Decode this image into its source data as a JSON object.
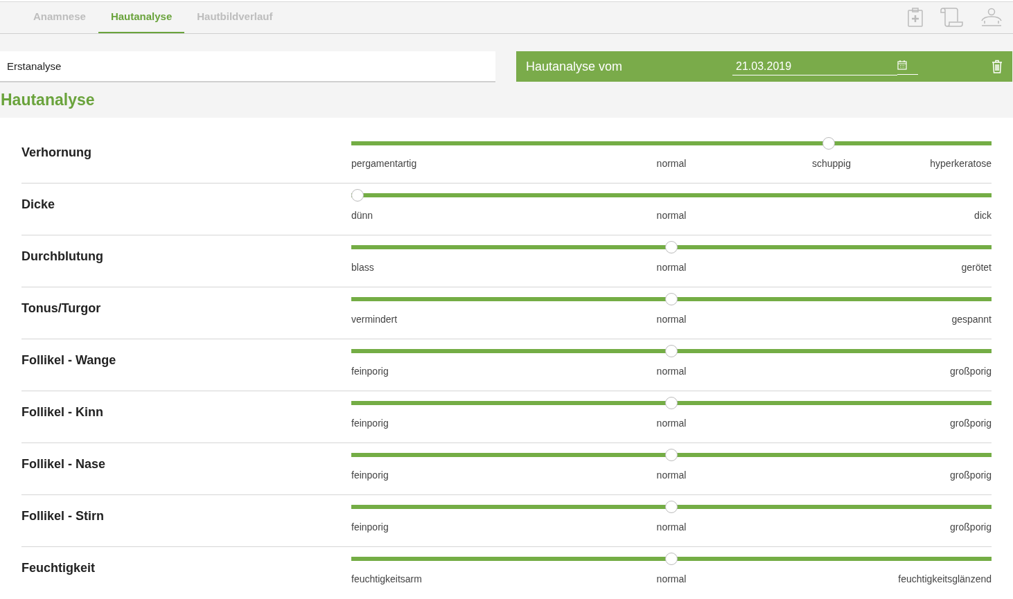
{
  "tabs": [
    {
      "label": "Anamnese",
      "selected": false
    },
    {
      "label": "Hautanalyse",
      "selected": true
    },
    {
      "label": "Hautbildverlauf",
      "selected": false
    }
  ],
  "analysis_name": {
    "value": "Erstanalyse"
  },
  "date_bar": {
    "label": "Hautanalyse vom",
    "date": "21.03.2019"
  },
  "section_title": "Hautanalyse",
  "rows": [
    {
      "name": "Verhornung",
      "level": 0.75,
      "scale": [
        "pergamentartig",
        "normal",
        "schuppig",
        "hyperkeratose"
      ]
    },
    {
      "name": "Dicke",
      "level": 0,
      "scale": [
        "dünn",
        "normal",
        "dick"
      ]
    },
    {
      "name": "Durchblutung",
      "level": 0.5,
      "scale": [
        "blass",
        "normal",
        "gerötet"
      ]
    },
    {
      "name": "Tonus/Turgor",
      "level": 0.5,
      "scale": [
        "vermindert",
        "normal",
        "gespannt"
      ]
    },
    {
      "name": "Follikel - Wange",
      "level": 0.5,
      "scale": [
        "feinporig",
        "normal",
        "großporig"
      ]
    },
    {
      "name": "Follikel - Kinn",
      "level": 0.5,
      "scale": [
        "feinporig",
        "normal",
        "großporig"
      ]
    },
    {
      "name": "Follikel - Nase",
      "level": 0.5,
      "scale": [
        "feinporig",
        "normal",
        "großporig"
      ]
    },
    {
      "name": "Follikel - Stirn",
      "level": 0.5,
      "scale": [
        "feinporig",
        "normal",
        "großporig"
      ]
    },
    {
      "name": "Feuchtigkeit",
      "level": 0.5,
      "scale": [
        "feuchtigkeitsarm",
        "normal",
        "feuchtigkeitsglänzend"
      ]
    }
  ]
}
